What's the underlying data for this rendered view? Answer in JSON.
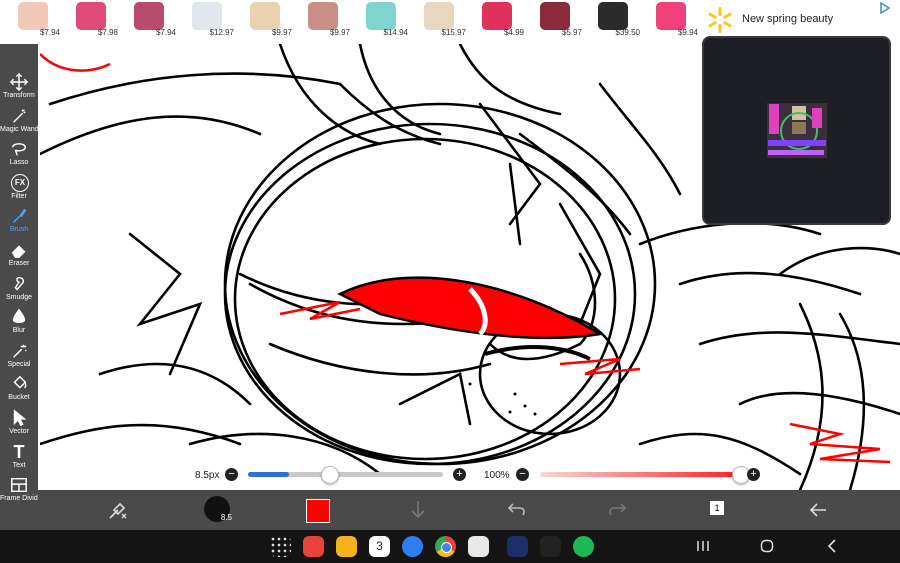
{
  "ad": {
    "items": [
      {
        "price": "$7.94",
        "color": "#f2c9b8"
      },
      {
        "price": "$7.98",
        "color": "#e04a78"
      },
      {
        "price": "$7.94",
        "color": "#b84a6d"
      },
      {
        "price": "$12.97",
        "color": "#dfe6ee"
      },
      {
        "price": "$9.97",
        "color": "#e8d2b0"
      },
      {
        "price": "$9.97",
        "color": "#c98f86"
      },
      {
        "price": "$14.94",
        "color": "#7fd4d0"
      },
      {
        "price": "$15.97",
        "color": "#ead7c2"
      },
      {
        "price": "$4.99",
        "color": "#e0305c"
      },
      {
        "price": "$5.97",
        "color": "#8a2a3a"
      },
      {
        "price": "$39.50",
        "color": "#2b2b2b"
      },
      {
        "price": "$9.94",
        "color": "#f0407a"
      }
    ],
    "brand_text": "New spring beauty",
    "brand_color": "#ffc220"
  },
  "tools": [
    {
      "label": "Transform",
      "icon": "move-arrows-icon"
    },
    {
      "label": "Magic Wand",
      "icon": "magic-wand-icon"
    },
    {
      "label": "Lasso",
      "icon": "lasso-icon"
    },
    {
      "label": "Filter",
      "icon": "fx-icon",
      "glyph": "FX"
    },
    {
      "label": "Brush",
      "icon": "brush-icon",
      "active": true
    },
    {
      "label": "Eraser",
      "icon": "eraser-icon"
    },
    {
      "label": "Smudge",
      "icon": "smudge-icon"
    },
    {
      "label": "Blur",
      "icon": "blur-drop-icon"
    },
    {
      "label": "Special",
      "icon": "sparkle-wand-icon"
    },
    {
      "label": "Bucket",
      "icon": "bucket-icon"
    },
    {
      "label": "Vector",
      "icon": "vector-cursor-icon"
    },
    {
      "label": "Text",
      "icon": "text-icon",
      "glyph": "T"
    },
    {
      "label": "Frame Divider",
      "icon": "frame-divider-icon"
    }
  ],
  "sliders": {
    "size": {
      "label": "8.5px",
      "value_fraction": 0.21
    },
    "opacity": {
      "label": "100%",
      "value_fraction": 1.0
    }
  },
  "bottom": {
    "brush_size_label": "8.5",
    "current_color": "#ff0000",
    "layer_count": "1"
  },
  "sysbar": {
    "apps": [
      {
        "name": "app-drawer-icon",
        "color": "#141414"
      },
      {
        "name": "notes-app-icon",
        "color": "#e8433b"
      },
      {
        "name": "folder-app-icon",
        "color": "#f5b11a"
      },
      {
        "name": "calendar-app-icon",
        "color": "#ffffff",
        "glyph": "3"
      },
      {
        "name": "messages-app-icon",
        "color": "#2f7ef0"
      },
      {
        "name": "chrome-app-icon",
        "color": "#ffffff"
      },
      {
        "name": "camera-app-icon",
        "color": "#e9e9e9"
      },
      {
        "name": "ibispaint-app-icon",
        "color": "#1d2f6b"
      },
      {
        "name": "bolt-app-icon",
        "color": "#222222"
      },
      {
        "name": "spotify-app-icon",
        "color": "#1db954"
      }
    ]
  }
}
